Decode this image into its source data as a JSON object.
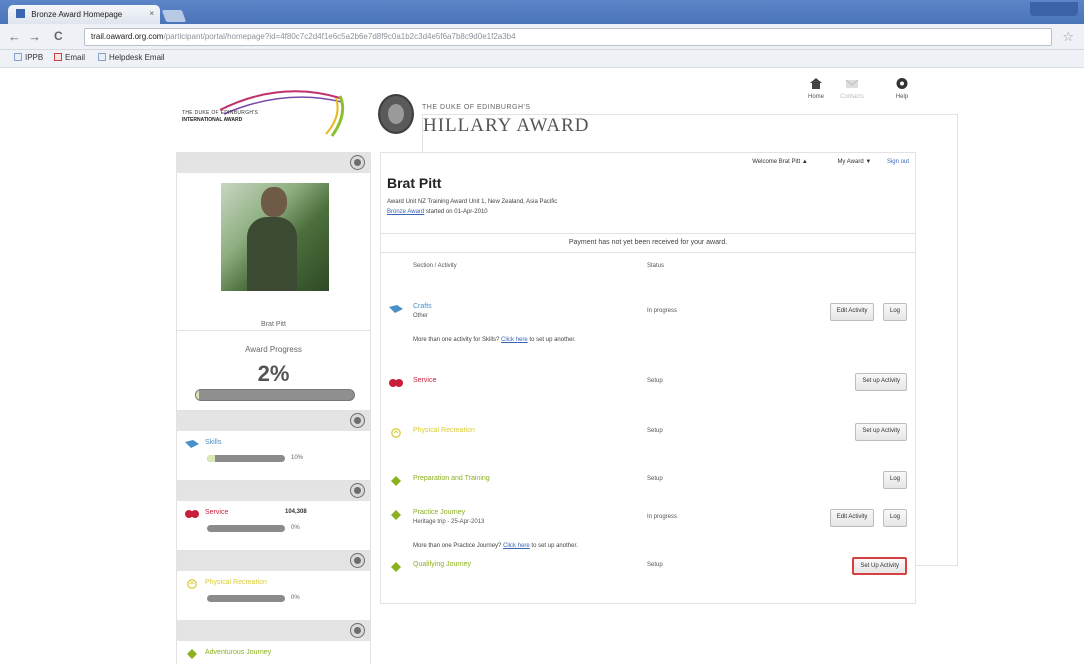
{
  "browser": {
    "tab_title": "Bronze Award Homepage",
    "tab_close": "×",
    "url_host": "trail.oaward.org.com",
    "url_rest": "/participant/portal/homepage?id=4f80c7c2d4f1e6c5a2b6e7d8f9c0a1b2c3d4e5f6a7b8c9d0e1f2a3b4",
    "bookmarks": [
      "IPPB",
      "Email",
      "Helpdesk Email"
    ],
    "nav": {
      "back": "←",
      "forward": "→",
      "reload": "C",
      "star": "☆"
    }
  },
  "header": {
    "intl_logo_line1": "THE DUKE OF EDINBURGH'S",
    "intl_logo_line2": "INTERNATIONAL AWARD",
    "hillary_sub": "THE DUKE OF EDINBURGH'S",
    "hillary_main": "HILLARY AWARD",
    "topnav": [
      {
        "label": "Home",
        "icon": "home-icon"
      },
      {
        "label": "Contacts",
        "icon": "envelope-icon"
      },
      {
        "label": "Help",
        "icon": "help-icon"
      }
    ]
  },
  "sidebar": {
    "profile_name": "Brat Pitt",
    "progress_label": "Award Progress",
    "progress_value": "2%",
    "progress_fraction": 0.02,
    "sections": [
      {
        "name": "Skills",
        "value": "",
        "percent": "10%",
        "fraction": 0.1,
        "color": "#4a90c8",
        "icon": "skills-icon"
      },
      {
        "name": "Service",
        "value": "104,308",
        "percent": "0%",
        "fraction": 0.0,
        "color": "#c8203c",
        "icon": "service-icon"
      },
      {
        "name": "Physical Recreation",
        "value": "",
        "percent": "0%",
        "fraction": 0.0,
        "color": "#d9cc3a",
        "icon": "physical-icon"
      },
      {
        "name": "Adventurous Journey",
        "value": "",
        "percent": "0%",
        "fraction": 0.0,
        "color": "#8cb020",
        "icon": "journey-icon"
      }
    ]
  },
  "main": {
    "welcome": "Welcome Brat Pitt",
    "my_award": "My Award",
    "sign_out": "Sign out",
    "person_name": "Brat Pitt",
    "meta_line1": "Award Unit NZ Training Award Unit 1, New Zealand, Asia Pacific",
    "meta_link": "Bronze Award",
    "meta_line2": "started on 01-Apr-2010",
    "payment_notice": "Payment has not yet been received for your award.",
    "col_section": "Section / Activity",
    "col_status": "Status",
    "rows": [
      {
        "name": "Crafts",
        "sub": "Other",
        "status": "In progress",
        "buttons": [
          "Edit Activity",
          "Log"
        ],
        "color": "#4a90c8",
        "icon": "skills-icon"
      },
      {
        "name": "Service",
        "sub": "",
        "status": "Setup",
        "buttons": [
          "Set up Activity"
        ],
        "color": "#c8203c",
        "icon": "service-icon"
      },
      {
        "name": "Physical Recreation",
        "sub": "",
        "status": "Setup",
        "buttons": [
          "Set up Activity"
        ],
        "color": "#d9cc3a",
        "icon": "physical-icon"
      },
      {
        "name": "Preparation and Training",
        "sub": "",
        "status": "Setup",
        "buttons": [
          "Log"
        ],
        "color": "#8cb020",
        "icon": "journey-icon"
      },
      {
        "name": "Practice Journey",
        "sub": "Heritage trip - 25-Apr-2013",
        "status": "In progress",
        "buttons": [
          "Edit Activity",
          "Log"
        ],
        "color": "#8cb020",
        "icon": "journey-icon"
      },
      {
        "name": "Qualifying Journey",
        "sub": "",
        "status": "Setup",
        "buttons": [
          "Set Up Activity"
        ],
        "color": "#8cb020",
        "icon": "journey-icon"
      }
    ],
    "note_skills": {
      "before": "More than one activity for Skills? ",
      "link": "Click here",
      "after": " to set up another."
    },
    "note_practice": {
      "before": "More than one Practice Journey? ",
      "link": "Click here",
      "after": " to set up another."
    }
  }
}
